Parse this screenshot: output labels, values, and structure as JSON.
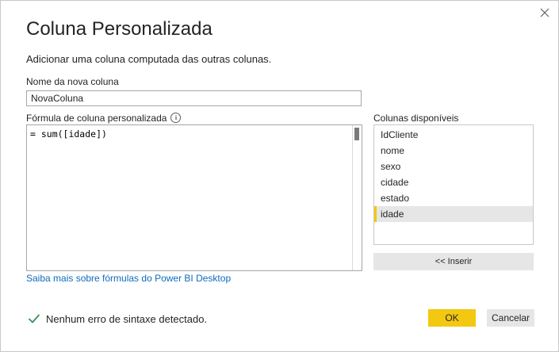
{
  "dialog": {
    "title": "Coluna Personalizada",
    "subtitle": "Adicionar uma coluna computada das outras colunas.",
    "close_icon": "close-icon"
  },
  "name_field": {
    "label": "Nome da nova coluna",
    "value": "NovaColuna"
  },
  "formula": {
    "label": "Fórmula de coluna personalizada",
    "info_icon": "info-icon",
    "text": "= sum([idade])"
  },
  "columns": {
    "label": "Colunas disponíveis",
    "items": [
      "IdCliente",
      "nome",
      "sexo",
      "cidade",
      "estado",
      "idade"
    ],
    "selected": "idade",
    "insert_label": "<< Inserir"
  },
  "learn_link": "Saiba mais sobre fórmulas do Power BI Desktop",
  "status": {
    "icon": "checkmark-icon",
    "text": "Nenhum erro de sintaxe detectado."
  },
  "buttons": {
    "ok": "OK",
    "cancel": "Cancelar"
  },
  "colors": {
    "accent": "#f2c811",
    "link": "#0f6cbd",
    "success": "#2e8b57"
  }
}
